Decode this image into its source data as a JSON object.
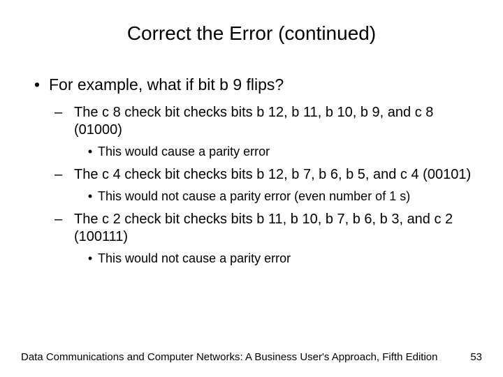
{
  "title": "Correct the Error (continued)",
  "bullets": {
    "l1": "For example, what if bit b 9 flips?",
    "l2a": "The c 8 check bit checks bits b 12, b 11, b 10, b 9, and c 8 (01000)",
    "l3a": "This would cause a parity error",
    "l2b": "The c 4 check bit checks bits b 12, b 7, b 6, b 5, and c 4 (00101)",
    "l3b": "This would not cause a parity error (even number of 1 s)",
    "l2c": "The c 2 check bit checks bits b 11, b 10, b 7, b 6, b 3, and c 2 (100111)",
    "l3c": "This would not cause a parity error"
  },
  "footer": {
    "source": "Data Communications and Computer Networks: A Business User's Approach, Fifth Edition",
    "page": "53"
  },
  "markers": {
    "dot": "•",
    "dash": "–"
  }
}
